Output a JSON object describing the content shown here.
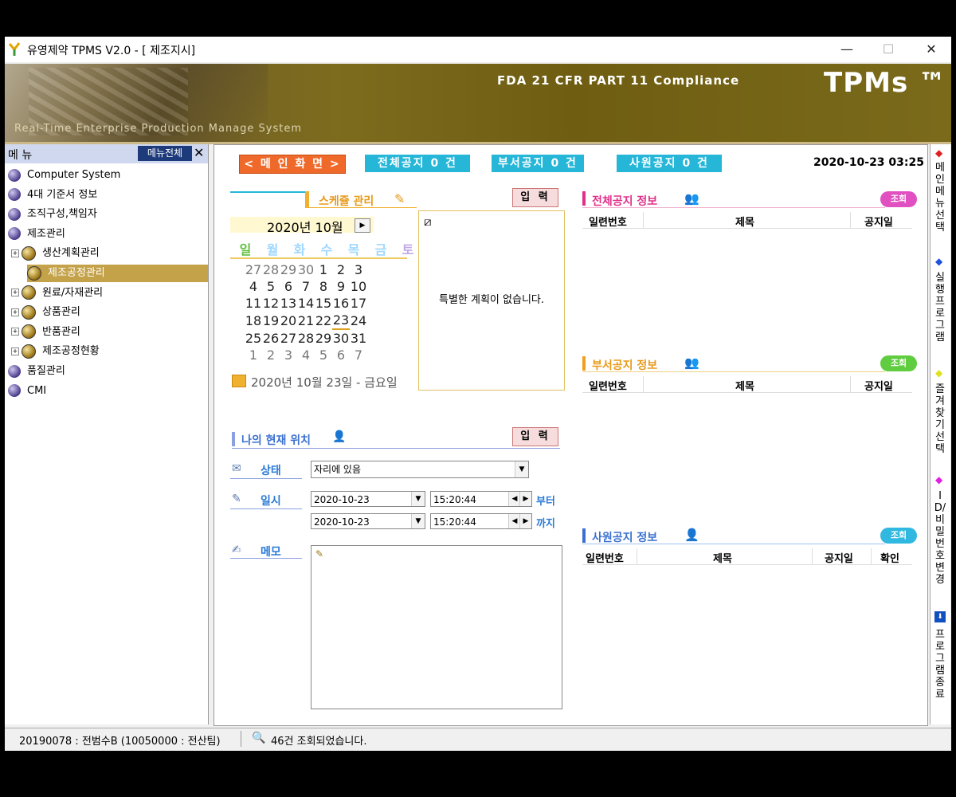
{
  "window": {
    "title": "유영제약  TPMS  V2.0 - [ 제조지시]",
    "minimize": "—",
    "maximize": "☐",
    "close": "✕"
  },
  "banner": {
    "compliance": "FDA 21 CFR PART 11 Compliance",
    "logo": "TPMs ™",
    "tagline": "Real-Time Enterprise Production Manage System"
  },
  "sidebar": {
    "header": "메 뉴",
    "all_menu": "메뉴전체",
    "close": "✕",
    "items": [
      {
        "label": "Computer System",
        "level": 0
      },
      {
        "label": "4대 기준서 정보",
        "level": 0
      },
      {
        "label": "조직구성,책임자",
        "level": 0
      },
      {
        "label": "제조관리",
        "level": 0
      },
      {
        "label": "생산계획관리",
        "level": 1
      },
      {
        "label": "제조공정관리",
        "level": 1,
        "selected": true
      },
      {
        "label": "원료/자재관리",
        "level": 1
      },
      {
        "label": "상품관리",
        "level": 1
      },
      {
        "label": "반품관리",
        "level": 1
      },
      {
        "label": "제조공정현황",
        "level": 1
      },
      {
        "label": "품질관리",
        "level": 0
      },
      {
        "label": "CMI",
        "level": 0
      }
    ]
  },
  "toolbar": {
    "main_screen": "< 메 인 화 면 >",
    "all_notice": "전체공지 0 건",
    "dept_notice": "부서공지 0 건",
    "staff_notice": "사원공지 0 건",
    "datetime": "2020-10-23 03:25"
  },
  "schedule": {
    "title": "스케쥴 관리",
    "input_button": "입 력",
    "month": "2020년 10월",
    "weekdays": [
      "일",
      "월",
      "화",
      "수",
      "목",
      "금",
      "토"
    ],
    "weeks": [
      [
        "27",
        "28",
        "29",
        "30",
        "1",
        "2",
        "3"
      ],
      [
        "4",
        "5",
        "6",
        "7",
        "8",
        "9",
        "10"
      ],
      [
        "11",
        "12",
        "13",
        "14",
        "15",
        "16",
        "17"
      ],
      [
        "18",
        "19",
        "20",
        "21",
        "22",
        "23",
        "24"
      ],
      [
        "25",
        "26",
        "27",
        "28",
        "29",
        "30",
        "31"
      ],
      [
        "1",
        "2",
        "3",
        "4",
        "5",
        "6",
        "7"
      ]
    ],
    "today_text": "2020년 10월 23일 - 금요일",
    "no_plan": "특별한 계획이 없습니다."
  },
  "location": {
    "title": "나의 현재 위치",
    "input_button": "입 력",
    "status_label": "상태",
    "status_value": "자리에 있음",
    "datetime_label": "일시",
    "from_date": "2020-10-23",
    "from_time": "15:20:44",
    "from_label": "부터",
    "to_date": "2020-10-23",
    "to_time": "15:20:44",
    "to_label": "까지",
    "memo_label": "메모"
  },
  "notices": {
    "all": {
      "title": "전체공지 정보",
      "more": "조회",
      "cols": [
        "일련번호",
        "제목",
        "공지일"
      ]
    },
    "dept": {
      "title": "부서공지 정보",
      "more": "조회",
      "cols": [
        "일련번호",
        "제목",
        "공지일"
      ]
    },
    "staff": {
      "title": "사원공지 정보",
      "more": "조회",
      "cols": [
        "일련번호",
        "제목",
        "공지일",
        "확인"
      ]
    }
  },
  "rightbar": {
    "items": [
      "메인메뉴선택",
      "실행프로그램",
      "즐겨찾기선택",
      "ID/비밀번호 변경",
      "프로그램종료"
    ]
  },
  "status": {
    "user": "20190078 : 전범수B (10050000 : 전산팀)",
    "message": "46건 조회되었습니다."
  },
  "colors": {
    "accent_orange": "#ef6a2a",
    "accent_cyan": "#25b6d8",
    "banner_olive": "#75651a",
    "selected_gold": "#c4a24a"
  }
}
